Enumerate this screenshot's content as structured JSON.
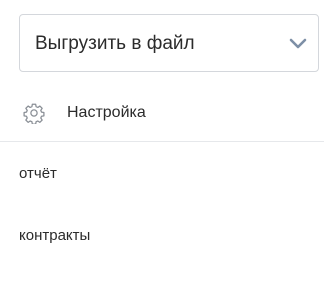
{
  "export": {
    "label": "Выгрузить в файл",
    "chevron_icon": "chevron-down-icon",
    "chevron_color": "#7d8fa6"
  },
  "menu": {
    "settings": {
      "icon": "gear-icon",
      "label": "Настройка"
    },
    "items": [
      {
        "label": "отчёт"
      },
      {
        "label": "контракты"
      }
    ]
  }
}
